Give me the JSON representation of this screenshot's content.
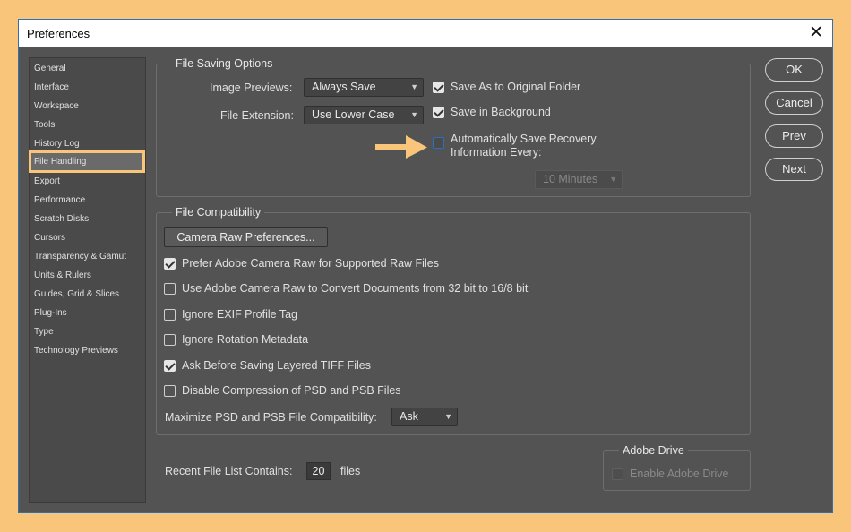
{
  "window": {
    "title": "Preferences"
  },
  "sidebar": {
    "items": [
      "General",
      "Interface",
      "Workspace",
      "Tools",
      "History Log",
      "File Handling",
      "Export",
      "Performance",
      "Scratch Disks",
      "Cursors",
      "Transparency & Gamut",
      "Units & Rulers",
      "Guides, Grid & Slices",
      "Plug-Ins",
      "Type",
      "Technology Previews"
    ],
    "selected": "File Handling"
  },
  "file_saving": {
    "legend": "File Saving Options",
    "image_previews_label": "Image Previews:",
    "image_previews_value": "Always Save",
    "file_extension_label": "File Extension:",
    "file_extension_value": "Use Lower Case",
    "save_as_original": {
      "label": "Save As to Original Folder",
      "checked": true
    },
    "save_in_background": {
      "label": "Save in Background",
      "checked": true
    },
    "auto_save": {
      "label_line1": "Automatically Save Recovery",
      "label_line2": "Information Every:",
      "checked": false
    },
    "interval_value": "10 Minutes"
  },
  "file_compat": {
    "legend": "File Compatibility",
    "camera_raw_button": "Camera Raw Preferences...",
    "options": [
      {
        "label": "Prefer Adobe Camera Raw for Supported Raw Files",
        "checked": true
      },
      {
        "label": "Use Adobe Camera Raw to Convert Documents from 32 bit to 16/8 bit",
        "checked": false
      },
      {
        "label": "Ignore EXIF Profile Tag",
        "checked": false
      },
      {
        "label": "Ignore Rotation Metadata",
        "checked": false
      },
      {
        "label": "Ask Before Saving Layered TIFF Files",
        "checked": true
      },
      {
        "label": "Disable Compression of PSD and PSB Files",
        "checked": false
      }
    ],
    "maximize_label": "Maximize PSD and PSB File Compatibility:",
    "maximize_value": "Ask"
  },
  "recent": {
    "label": "Recent File List Contains:",
    "value": "20",
    "suffix": "files"
  },
  "adobe_drive": {
    "legend": "Adobe Drive",
    "label": "Enable Adobe Drive"
  },
  "buttons": {
    "ok": "OK",
    "cancel": "Cancel",
    "prev": "Prev",
    "next": "Next"
  },
  "colors": {
    "background": "#F8C57A",
    "dialog": "#535353",
    "highlight": "#F8C57A",
    "checkbox_focus": "#2b6fc0"
  },
  "icons": {
    "close": "close-icon",
    "chevron": "chevron-down-icon",
    "arrow": "arrow-right-icon"
  }
}
